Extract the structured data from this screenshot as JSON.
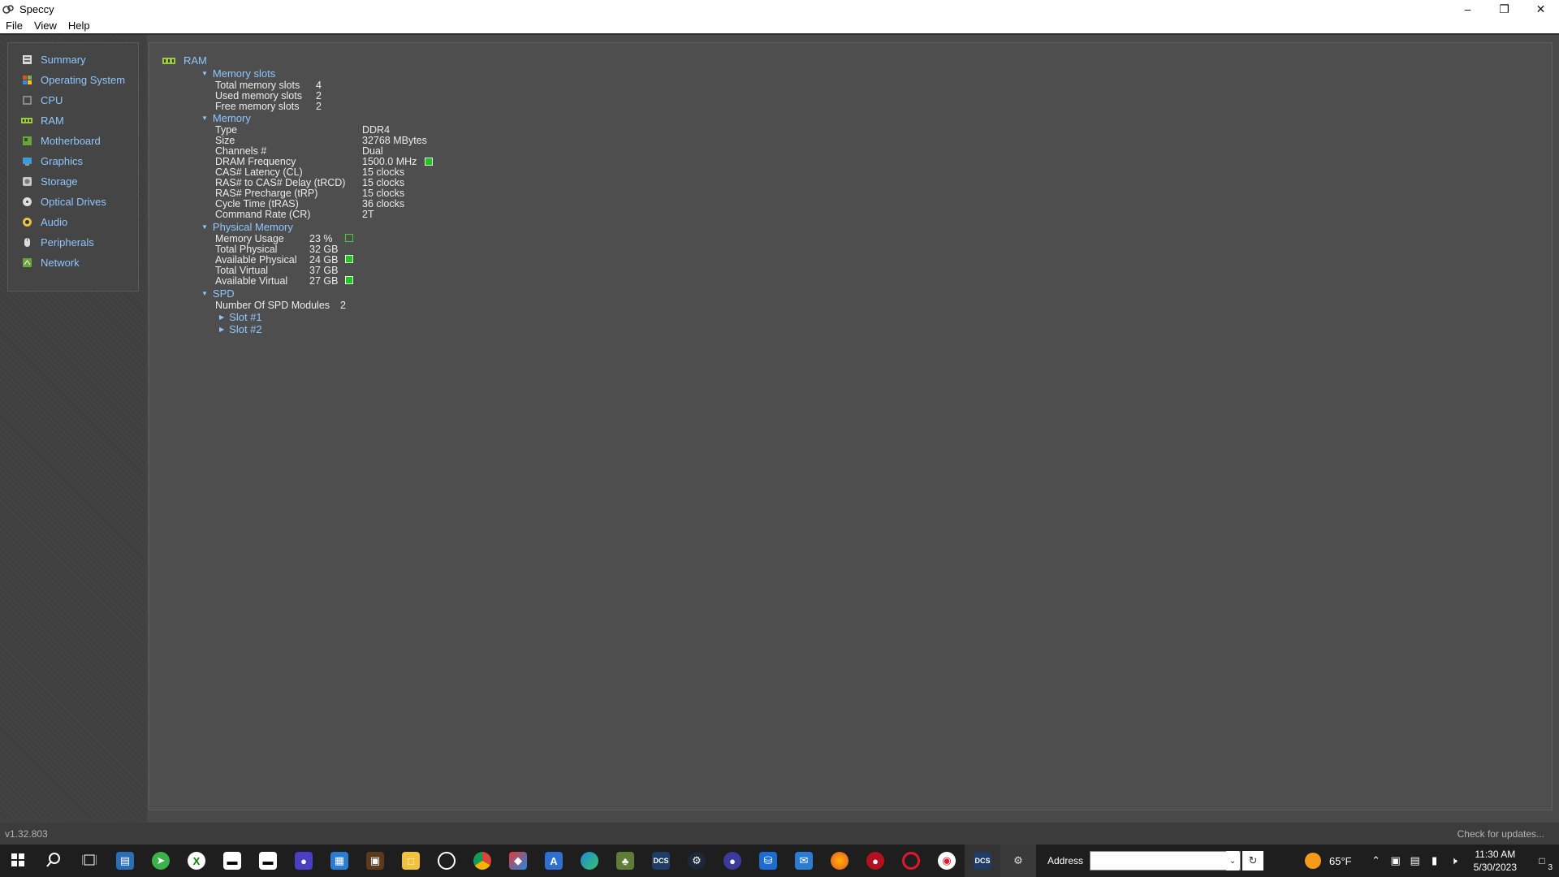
{
  "window": {
    "title": "Speccy"
  },
  "menu": [
    "File",
    "View",
    "Help"
  ],
  "sidebar": {
    "items": [
      {
        "label": "Summary",
        "icon": "summary-icon",
        "color": "#d9d9d9"
      },
      {
        "label": "Operating System",
        "icon": "windows-icon",
        "color": "#e0502a"
      },
      {
        "label": "CPU",
        "icon": "cpu-icon",
        "color": "#bdbdbd"
      },
      {
        "label": "RAM",
        "icon": "ram-icon",
        "color": "#9ccc3a"
      },
      {
        "label": "Motherboard",
        "icon": "motherboard-icon",
        "color": "#6aa43a"
      },
      {
        "label": "Graphics",
        "icon": "graphics-icon",
        "color": "#3d9bd6"
      },
      {
        "label": "Storage",
        "icon": "storage-icon",
        "color": "#c8c8c8"
      },
      {
        "label": "Optical Drives",
        "icon": "disc-icon",
        "color": "#dddddd"
      },
      {
        "label": "Audio",
        "icon": "speaker-icon",
        "color": "#e8c24a"
      },
      {
        "label": "Peripherals",
        "icon": "mouse-icon",
        "color": "#dcdcdc"
      },
      {
        "label": "Network",
        "icon": "network-icon",
        "color": "#6aa43a"
      }
    ]
  },
  "main": {
    "section": "RAM",
    "memory_slots": {
      "title": "Memory slots",
      "rows": [
        {
          "k": "Total memory slots",
          "v": "4"
        },
        {
          "k": "Used memory slots",
          "v": "2"
        },
        {
          "k": "Free memory slots",
          "v": "2"
        }
      ]
    },
    "memory": {
      "title": "Memory",
      "rows": [
        {
          "k": "Type",
          "v": "DDR4"
        },
        {
          "k": "Size",
          "v": "32768 MBytes"
        },
        {
          "k": "Channels #",
          "v": "Dual"
        },
        {
          "k": "DRAM Frequency",
          "v": "1500.0 MHz"
        },
        {
          "k": "CAS# Latency (CL)",
          "v": "15 clocks"
        },
        {
          "k": "RAS# to CAS# Delay (tRCD)",
          "v": "15 clocks"
        },
        {
          "k": "RAS# Precharge (tRP)",
          "v": "15 clocks"
        },
        {
          "k": "Cycle Time (tRAS)",
          "v": "36 clocks"
        },
        {
          "k": "Command Rate (CR)",
          "v": "2T"
        }
      ]
    },
    "physical_memory": {
      "title": "Physical Memory",
      "rows": [
        {
          "k": "Memory Usage",
          "v": "23 %"
        },
        {
          "k": "Total Physical",
          "v": "32 GB"
        },
        {
          "k": "Available Physical",
          "v": "24 GB"
        },
        {
          "k": "Total Virtual",
          "v": "37 GB"
        },
        {
          "k": "Available Virtual",
          "v": "27 GB"
        }
      ]
    },
    "spd": {
      "title": "SPD",
      "modules_label": "Number Of SPD Modules",
      "modules_value": "2",
      "slots": [
        "Slot #1",
        "Slot #2"
      ]
    }
  },
  "status": {
    "version": "v1.32.803",
    "update": "Check for updates..."
  },
  "taskbar": {
    "icons": [
      "windows-start-icon",
      "search-icon",
      "task-view-icon",
      "files-icon",
      "telegram-icon",
      "xbox-icon",
      "app-window-icon",
      "app-window2-icon",
      "app-icon",
      "store-icon",
      "minecraft-icon",
      "file-explorer-icon",
      "app-icon",
      "chrome-icon",
      "app-icon",
      "text-editor-icon",
      "edge-icon",
      "app-icon",
      "dcs-icon",
      "steam-icon",
      "app-icon",
      "vpn-icon",
      "mail-icon",
      "firefox-icon",
      "app-icon",
      "opera-icon",
      "app-icon",
      "dcs-icon",
      "speccy-icon"
    ],
    "address_label": "Address",
    "address_value": "",
    "temperature": "65°F",
    "time": "11:30 AM",
    "date": "5/30/2023",
    "notifications": "3"
  }
}
